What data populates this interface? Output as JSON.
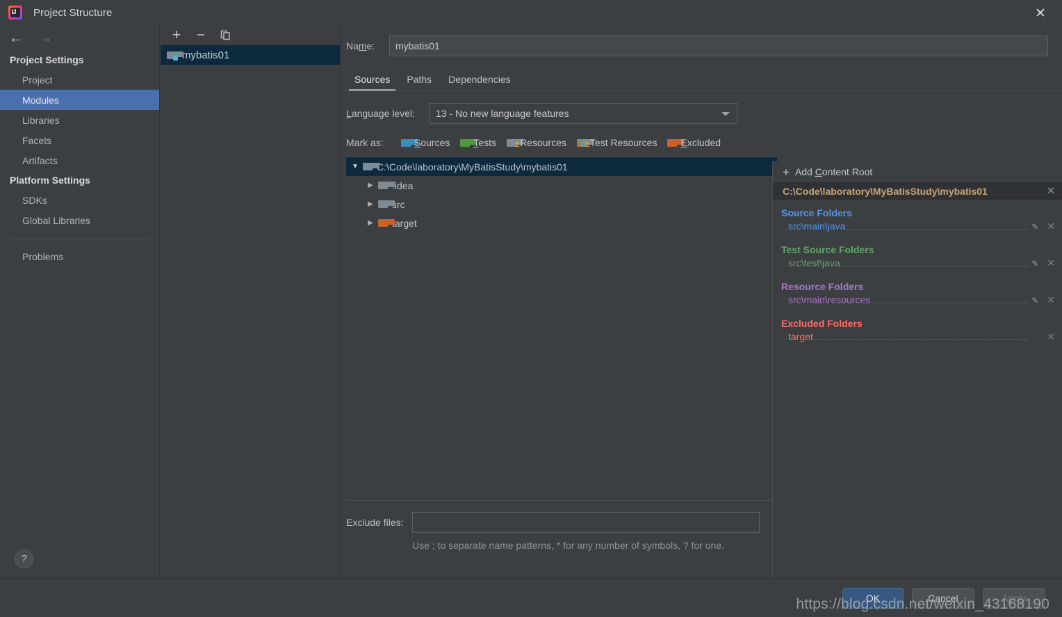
{
  "window": {
    "title": "Project Structure",
    "logo_text": "IJ",
    "close_label": "✕"
  },
  "sidebar": {
    "nav": {
      "back": "←",
      "forward": "→"
    },
    "groups": [
      {
        "title": "Project Settings",
        "items": [
          {
            "label": "Project",
            "selected": false
          },
          {
            "label": "Modules",
            "selected": true
          },
          {
            "label": "Libraries",
            "selected": false
          },
          {
            "label": "Facets",
            "selected": false
          },
          {
            "label": "Artifacts",
            "selected": false
          }
        ]
      },
      {
        "title": "Platform Settings",
        "items": [
          {
            "label": "SDKs",
            "selected": false
          },
          {
            "label": "Global Libraries",
            "selected": false
          }
        ]
      }
    ],
    "problems_label": "Problems",
    "help_label": "?"
  },
  "modules_pane": {
    "toolbar": {
      "add": "+",
      "remove": "−",
      "copy": "copy-icon"
    },
    "items": [
      {
        "label": "mybatis01",
        "selected": true
      }
    ]
  },
  "main": {
    "name_label": "Name:",
    "name_value": "mybatis01",
    "tabs": [
      {
        "label": "Sources",
        "active": true
      },
      {
        "label": "Paths",
        "active": false
      },
      {
        "label": "Dependencies",
        "active": false
      }
    ],
    "language_level_label": "Language level:",
    "language_level_value": "13 - No new language features",
    "mark_as_label": "Mark as:",
    "mark_as_options": [
      {
        "label": "Sources",
        "color": "#3b8ebb",
        "kind": "sources"
      },
      {
        "label": "Tests",
        "color": "#539a3c",
        "kind": "tests"
      },
      {
        "label": "Resources",
        "color": "#7f8a93",
        "kind": "resources"
      },
      {
        "label": "Test Resources",
        "color": "#7f8a93",
        "kind": "test-resources"
      },
      {
        "label": "Excluded",
        "color": "#c8612c",
        "kind": "excluded"
      }
    ],
    "tree": [
      {
        "label": "C:\\Code\\laboratory\\MyBatisStudy\\mybatis01",
        "depth": 0,
        "expanded": true,
        "selected": true,
        "folder": "gray"
      },
      {
        "label": ".idea",
        "depth": 1,
        "expanded": false,
        "selected": false,
        "folder": "gray"
      },
      {
        "label": "src",
        "depth": 1,
        "expanded": false,
        "selected": false,
        "folder": "gray"
      },
      {
        "label": "target",
        "depth": 1,
        "expanded": false,
        "selected": false,
        "folder": "orange"
      }
    ],
    "exclude_files_label": "Exclude files:",
    "exclude_files_value": "",
    "exclude_hint": "Use ; to separate name patterns, * for any number of symbols, ? for one."
  },
  "right_panel": {
    "add_content_root_label": "Add Content Root",
    "content_root_path": "C:\\Code\\laboratory\\MyBatisStudy\\mybatis01",
    "groups": [
      {
        "title": "Source Folders",
        "color": "#5394ec",
        "entries": [
          {
            "path": "src\\main\\java",
            "editable": true
          }
        ]
      },
      {
        "title": "Test Source Folders",
        "color": "#62a569",
        "entries": [
          {
            "path": "src\\test\\java",
            "editable": true
          }
        ]
      },
      {
        "title": "Resource Folders",
        "color": "#a977c6",
        "entries": [
          {
            "path": "src\\main\\resources",
            "editable": true
          }
        ]
      },
      {
        "title": "Excluded Folders",
        "color": "#ff6b68",
        "entries": [
          {
            "path": "target",
            "editable": false
          }
        ]
      }
    ]
  },
  "footer": {
    "ok": "OK",
    "cancel": "Cancel",
    "apply": "Apply"
  },
  "watermark": "https://blog.csdn.net/weixin_43168190"
}
